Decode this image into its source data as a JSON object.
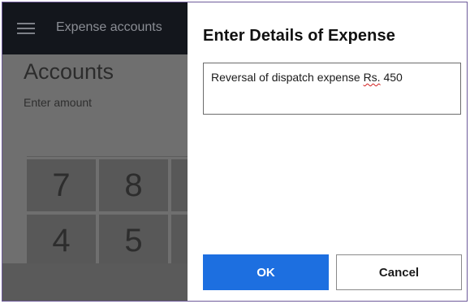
{
  "app": {
    "title": "Expense accounts",
    "heading": "Accounts",
    "amount_label": "Enter amount",
    "keypad": {
      "row1": [
        "7",
        "8"
      ],
      "row2": [
        "4",
        "5"
      ]
    }
  },
  "dialog": {
    "title": "Enter Details of Expense",
    "input": {
      "text_before": "Reversal of dispatch expense ",
      "misspelled": "Rs.",
      "text_after": " 450"
    },
    "ok_label": "OK",
    "cancel_label": "Cancel"
  },
  "colors": {
    "accent": "#1d6fe0",
    "appbar": "#13161c",
    "frame_border": "#6e5b9a",
    "spellcheck": "#d21f1f"
  },
  "icons": [
    "hamburger-menu-icon"
  ]
}
